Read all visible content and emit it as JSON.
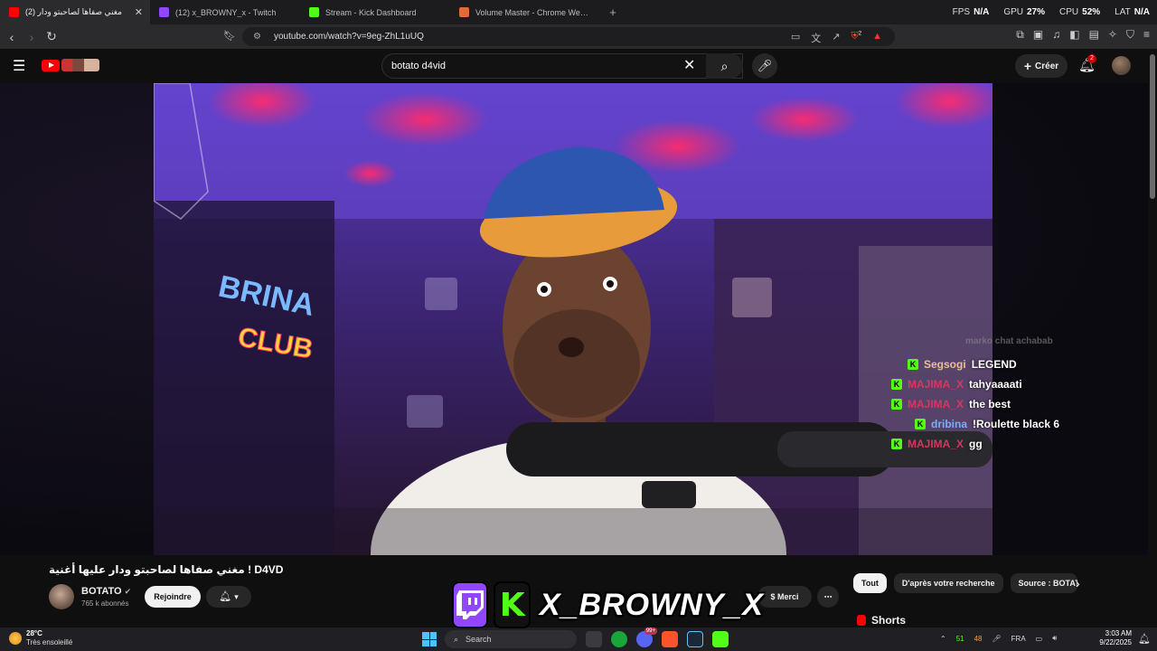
{
  "browser": {
    "tabs": [
      {
        "label": "(2) مغني صفاها لصاحبتو ودار",
        "color": "#ff0000",
        "active": true
      },
      {
        "label": "(12) x_BROWNY_x - Twitch",
        "color": "#9146ff",
        "active": false
      },
      {
        "label": "Stream - Kick Dashboard",
        "color": "#53fc18",
        "active": false
      },
      {
        "label": "Volume Master - Chrome Web Store",
        "color": "#e06a3a",
        "active": false
      }
    ],
    "new_tab": "+",
    "perf": [
      {
        "label": "FPS",
        "value": "N/A"
      },
      {
        "label": "GPU",
        "value": "27%"
      },
      {
        "label": "CPU",
        "value": "52%"
      },
      {
        "label": "LAT",
        "value": "N/A"
      }
    ],
    "url": "youtube.com/watch?v=9eg-ZhL1uUQ",
    "shield_count": "2"
  },
  "youtube": {
    "search_value": "botato d4vid",
    "create_label": "Créer",
    "notif_count": "2",
    "video_title": "مغني صفاها لصاحبتو ودار عليها أغنية ! D4VD",
    "channel_name": "BOTATO",
    "subscribers": "765 k abonnés",
    "join_label": "Rejoindre",
    "thanks_label": "Merci",
    "more_label": "⋯",
    "chips": [
      "Tout",
      "D'après votre recherche",
      "Source : BOTATO"
    ],
    "shorts_label": "Shorts"
  },
  "stream_chat": {
    "header": "marko chat achabab",
    "messages": [
      {
        "user": "Segsogi",
        "text": "LEGEND",
        "color": "#f5c49a",
        "platform": "kick"
      },
      {
        "user": "MAJIMA_X",
        "text": "tahyaaaati",
        "color": "#e0365f",
        "platform": "kick"
      },
      {
        "user": "MAJIMA_X",
        "text": "the best",
        "color": "#e0365f",
        "platform": "kick"
      },
      {
        "user": "dribina",
        "text": "!Roulette black 6",
        "color": "#7ab6ff",
        "platform": "kick"
      },
      {
        "user": "MAJIMA_X",
        "text": "gg",
        "color": "#e0365f",
        "platform": "kick"
      }
    ],
    "neon_sign": [
      "BRINA",
      "CLUB"
    ]
  },
  "overlay": {
    "name": "X_BROWNY_X",
    "twitch_color": "#9146ff",
    "kick_color": "#53fc18"
  },
  "taskbar": {
    "temperature": "28°C",
    "weather": "Très ensoleillé",
    "search_placeholder": "Search",
    "mail_badge": "99+",
    "tray_a": "51",
    "tray_b": "48",
    "language": "FRA",
    "time": "3:03 AM",
    "date": "9/22/2025"
  }
}
